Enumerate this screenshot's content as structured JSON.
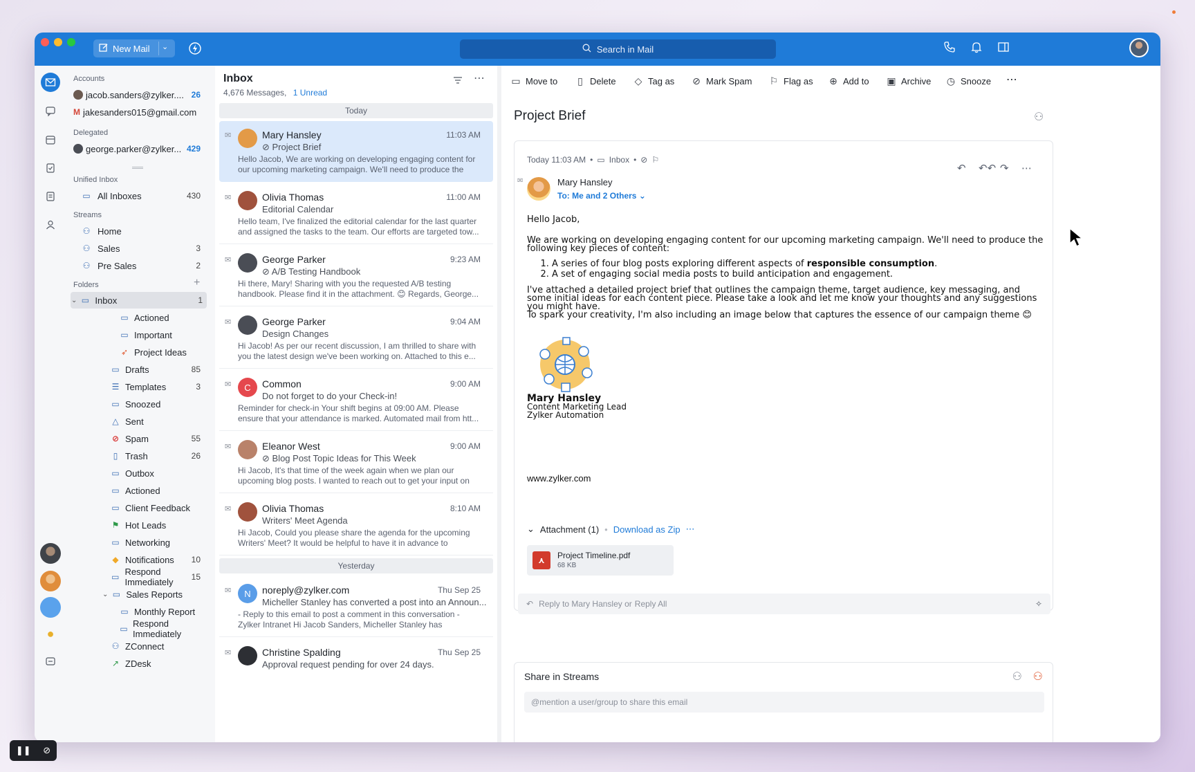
{
  "titlebar": {
    "new_mail": "New Mail",
    "search_placeholder": "Search in Mail"
  },
  "accounts": {
    "section": "Accounts",
    "items": [
      {
        "label": "jacob.sanders@zylker....",
        "count": "26"
      },
      {
        "label": "jakesanders015@gmail.com",
        "count": ""
      }
    ]
  },
  "delegated": {
    "section": "Delegated",
    "items": [
      {
        "label": "george.parker@zylker...",
        "count": "429"
      }
    ]
  },
  "unified": {
    "section": "Unified Inbox",
    "items": [
      {
        "label": "All Inboxes",
        "count": "430"
      }
    ]
  },
  "streams": {
    "section": "Streams",
    "items": [
      {
        "label": "Home",
        "count": ""
      },
      {
        "label": "Sales",
        "count": "3"
      },
      {
        "label": "Pre Sales",
        "count": "2"
      }
    ]
  },
  "folders": {
    "section": "Folders",
    "items": [
      {
        "label": "Inbox",
        "count": "1"
      },
      {
        "label": "Actioned",
        "count": ""
      },
      {
        "label": "Important",
        "count": ""
      },
      {
        "label": "Project Ideas",
        "count": ""
      },
      {
        "label": "Drafts",
        "count": "85"
      },
      {
        "label": "Templates",
        "count": "3"
      },
      {
        "label": "Snoozed",
        "count": ""
      },
      {
        "label": "Sent",
        "count": ""
      },
      {
        "label": "Spam",
        "count": "55"
      },
      {
        "label": "Trash",
        "count": "26"
      },
      {
        "label": "Outbox",
        "count": ""
      },
      {
        "label": "Actioned",
        "count": ""
      },
      {
        "label": "Client Feedback",
        "count": ""
      },
      {
        "label": "Hot Leads",
        "count": ""
      },
      {
        "label": "Networking",
        "count": ""
      },
      {
        "label": "Notifications",
        "count": "10"
      },
      {
        "label": "Respond Immediately",
        "count": "15"
      },
      {
        "label": "Sales Reports",
        "count": ""
      },
      {
        "label": "Monthly Report",
        "count": ""
      },
      {
        "label": "Respond Immediately",
        "count": ""
      },
      {
        "label": "ZConnect",
        "count": ""
      },
      {
        "label": "ZDesk",
        "count": ""
      }
    ]
  },
  "list": {
    "title": "Inbox",
    "message_count": "4,676 Messages,",
    "unread": "1 Unread",
    "today": "Today",
    "yesterday": "Yesterday",
    "messages": [
      {
        "sender": "Mary Hansley",
        "time": "11:03 AM",
        "subject": "Project Brief",
        "preview": "Hello Jacob, We are working on developing engaging content for our upcoming marketing campaign. We'll need to produce the fol...",
        "avatar_color": "#e39a47",
        "initial": ""
      },
      {
        "sender": "Olivia Thomas",
        "time": "11:00 AM",
        "subject": "Editorial Calendar",
        "preview": "Hello team, I've finalized the editorial calendar for the last quarter and assigned the tasks to the team. Our efforts are targeted tow...",
        "avatar_color": "#a0523d",
        "initial": ""
      },
      {
        "sender": "George Parker",
        "time": "9:23 AM",
        "subject": "A/B Testing Handbook",
        "preview": "Hi there, Mary! Sharing with you the requested A/B testing handbook. Please find it in the attachment. 😊 Regards, George...",
        "avatar_color": "#4a4d55",
        "initial": ""
      },
      {
        "sender": "George Parker",
        "time": "9:04 AM",
        "subject": "Design Changes",
        "preview": "Hi Jacob! As per our recent discussion, I am thrilled to share with you the latest design we've been working on. Attached to this e...",
        "avatar_color": "#4a4d55",
        "initial": ""
      },
      {
        "sender": "Common",
        "time": "9:00 AM",
        "subject": "Do not forget to do your Check-in!",
        "preview": "Reminder for check-in Your shift begins at 09:00 AM. Please ensure that your attendance is marked. Automated mail from htt...",
        "avatar_color": "#e5484d",
        "initial": "C"
      },
      {
        "sender": "Eleanor West",
        "time": "9:00 AM",
        "subject": "Blog Post Topic Ideas for This Week",
        "preview": "Hi Jacob, It's that time of the week again when we plan our upcoming blog posts. I wanted to reach out to get your input on t...",
        "avatar_color": "#b9826a",
        "initial": ""
      },
      {
        "sender": "Olivia Thomas",
        "time": "8:10 AM",
        "subject": "Writers' Meet Agenda",
        "preview": "Hi Jacob, Could you please share the agenda for the upcoming Writers' Meet? It would be helpful to have it in advance to prepar...",
        "avatar_color": "#a0523d",
        "initial": ""
      },
      {
        "sender": "noreply@zylker.com",
        "time": "Thu Sep 25",
        "subject": "Micheller Stanley has converted a post into an Announ...",
        "preview": "- Reply to this email to post a comment in this conversation - Zylker Intranet Hi Jacob Sanders, Micheller Stanley has converte...",
        "avatar_color": "#5a9de8",
        "initial": "N"
      },
      {
        "sender": "Christine Spalding",
        "time": "Thu Sep 25",
        "subject": "Approval request pending for over 24 days.",
        "preview": "",
        "avatar_color": "#2d2f34",
        "initial": ""
      }
    ]
  },
  "toolbar": {
    "move_to": "Move to",
    "delete": "Delete",
    "tag_as": "Tag as",
    "mark_spam": "Mark Spam",
    "flag_as": "Flag as",
    "add_to": "Add to",
    "archive": "Archive",
    "snooze": "Snooze"
  },
  "email": {
    "subject": "Project Brief",
    "date": "Today 11:03 AM",
    "folder": "Inbox",
    "sender": "Mary Hansley",
    "to": "To: Me and 2 Others",
    "greeting": "Hello Jacob,",
    "para1": "We are working on developing engaging content for our upcoming marketing campaign. We'll need to produce the following key pieces of content:",
    "item1_pre": "A series of four blog posts exploring different aspects of ",
    "item1_bold": "responsible consumption",
    "item1_post": ".",
    "item2": "A set of engaging social media posts to build anticipation and engagement.",
    "para2": "I've attached a detailed project brief that outlines the campaign theme, target audience, key messaging, and some initial ideas for each content piece. Please take a look and let me know your thoughts and any suggestions you might have.",
    "para3": "To spark your creativity, I'm also including an image below that captures the essence of our campaign theme 😊",
    "sig_name": "Mary Hansley",
    "sig_title": "Content Marketing Lead",
    "sig_company": "Zylker Automation",
    "website": "www.zylker.com",
    "attachment_label": "Attachment (1)",
    "download_zip": "Download as Zip",
    "file_name": "Project Timeline.pdf",
    "file_size": "68 KB",
    "reply_placeholder": "Reply to Mary Hansley or",
    "reply_all": "Reply All"
  },
  "share": {
    "title": "Share in Streams",
    "placeholder": "@mention a user/group to share this email"
  }
}
